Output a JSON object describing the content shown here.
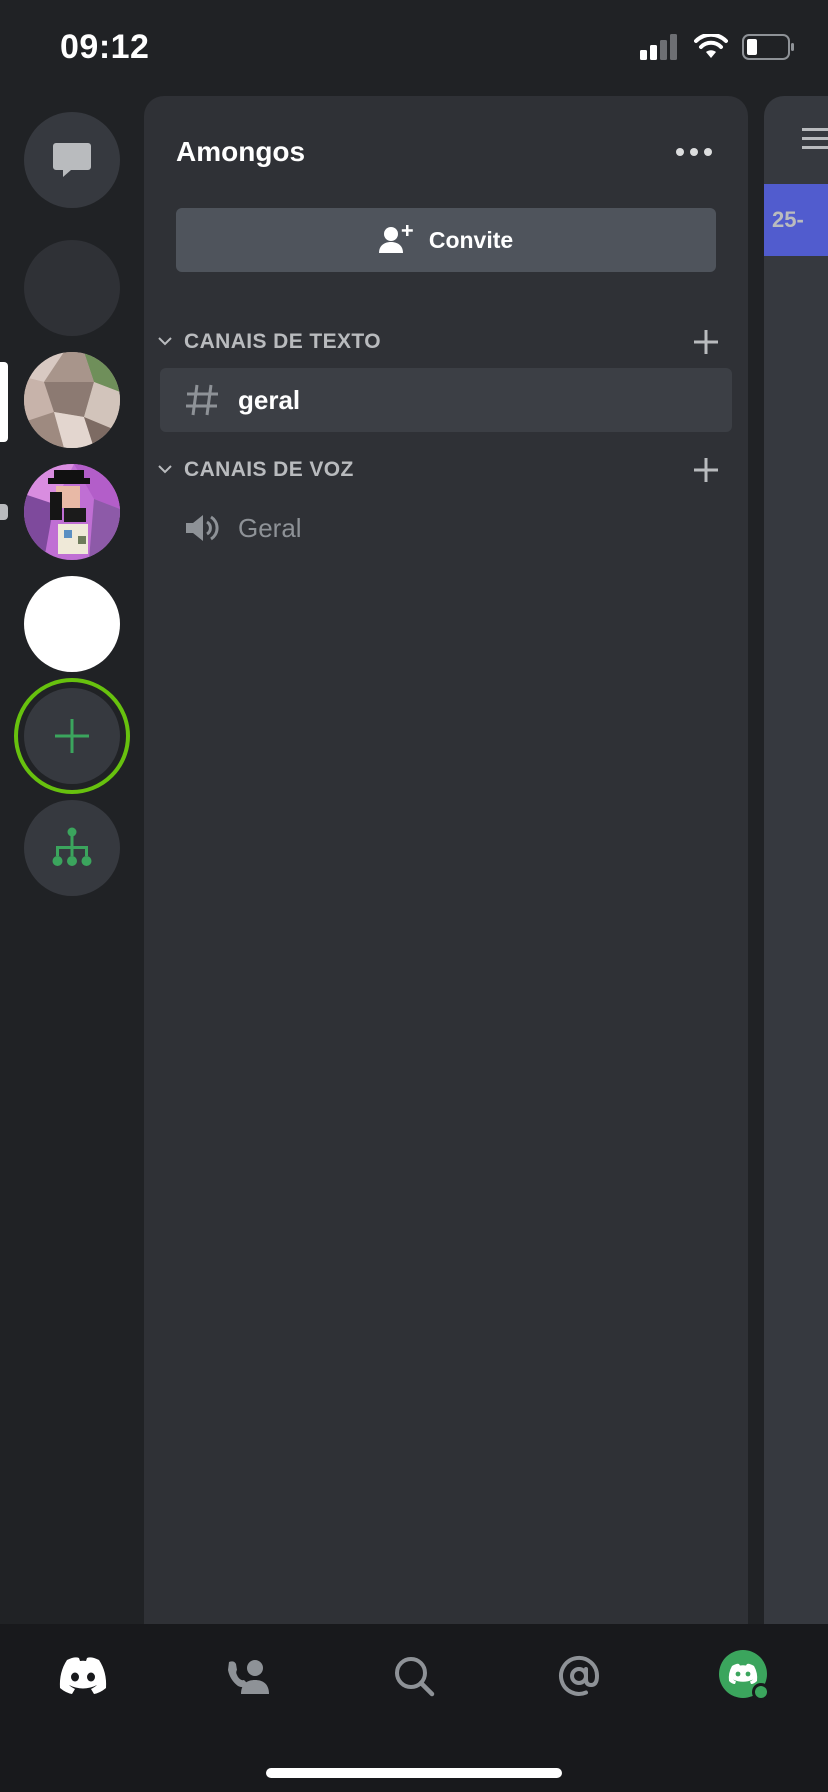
{
  "status": {
    "time": "09:12"
  },
  "server": {
    "name": "Amongos",
    "invite_label": "Convite"
  },
  "categories": [
    {
      "label": "CANAIS DE TEXTO",
      "channels": [
        {
          "name": "geral",
          "kind": "text",
          "selected": true
        }
      ]
    },
    {
      "label": "CANAIS DE VOZ",
      "channels": [
        {
          "name": "Geral",
          "kind": "voice",
          "selected": false
        }
      ]
    }
  ],
  "right_strip": {
    "banner_text": "25-"
  },
  "rail": {
    "items": [
      "direct-messages-icon",
      "server-blank",
      "server-mosaic-green",
      "server-avatar-purple",
      "server-white",
      "add-server-icon",
      "explore-servers-icon"
    ]
  },
  "tabs": [
    "home-icon",
    "friends-icon",
    "search-icon",
    "mentions-icon",
    "profile-avatar"
  ],
  "colors": {
    "accent": "#5865f2",
    "green": "#3ba55d",
    "highlight_arrow": "#67c10e",
    "background": "#202225",
    "panel": "#2f3136"
  }
}
